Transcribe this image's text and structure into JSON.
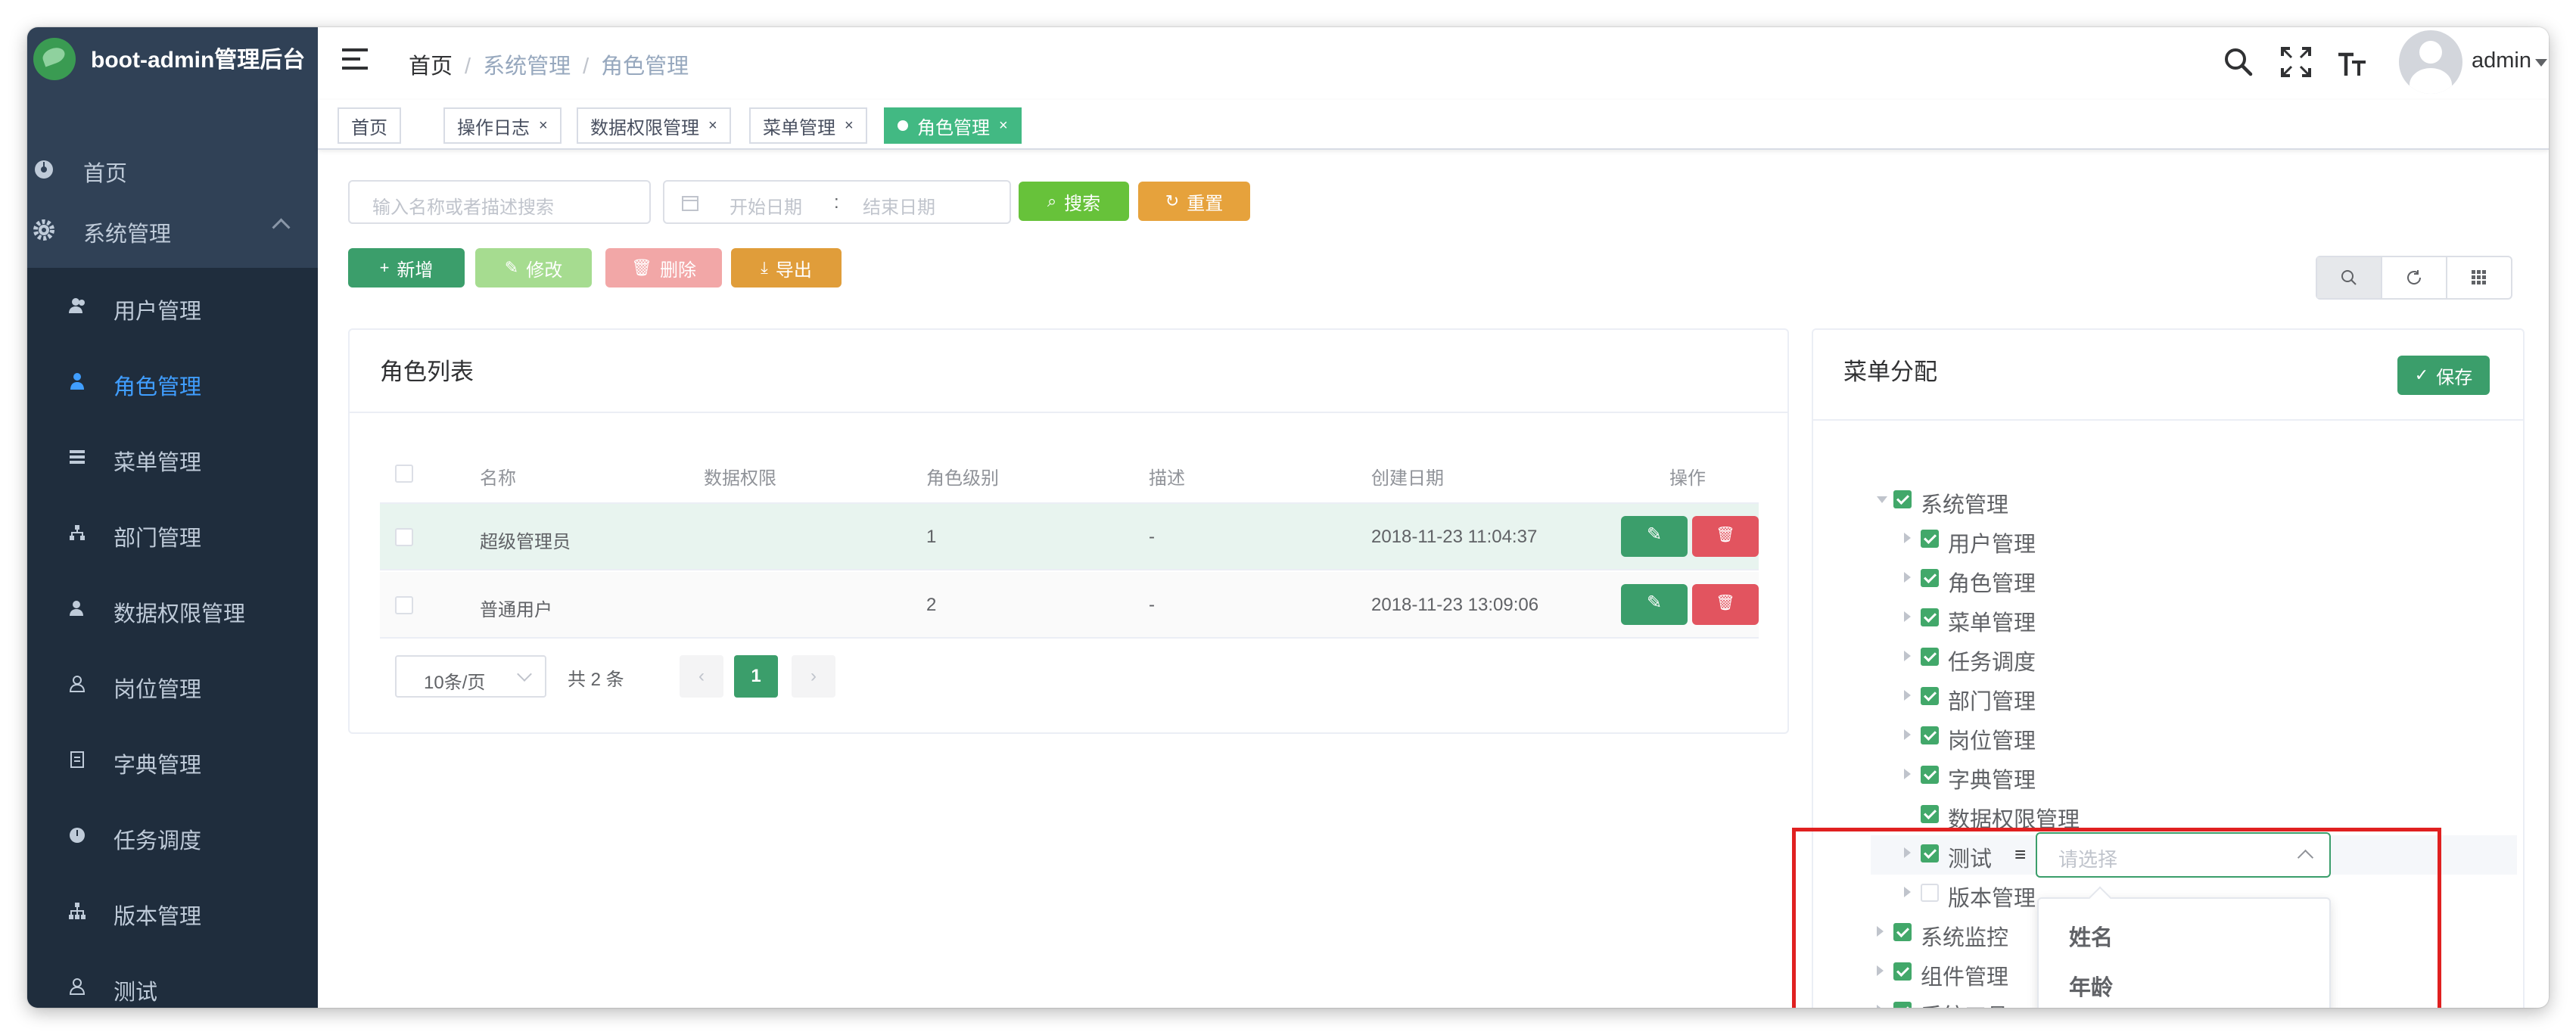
{
  "app": {
    "title": "boot-admin管理后台"
  },
  "sidebar": {
    "home": "首页",
    "group": "系统管理",
    "items": [
      {
        "label": "用户管理",
        "icon": "user-icon"
      },
      {
        "label": "角色管理",
        "icon": "role-icon",
        "active": true
      },
      {
        "label": "菜单管理",
        "icon": "menu-icon"
      },
      {
        "label": "部门管理",
        "icon": "dept-icon"
      },
      {
        "label": "数据权限管理",
        "icon": "data-perm-icon"
      },
      {
        "label": "岗位管理",
        "icon": "post-icon"
      },
      {
        "label": "字典管理",
        "icon": "dict-icon"
      },
      {
        "label": "任务调度",
        "icon": "task-icon"
      },
      {
        "label": "版本管理",
        "icon": "version-icon"
      },
      {
        "label": "测试",
        "icon": "test-icon"
      }
    ]
  },
  "header": {
    "breadcrumb": [
      "首页",
      "系统管理",
      "角色管理"
    ],
    "username": "admin"
  },
  "tags": [
    {
      "label": "首页",
      "closable": false
    },
    {
      "label": "操作日志",
      "closable": true
    },
    {
      "label": "数据权限管理",
      "closable": true
    },
    {
      "label": "菜单管理",
      "closable": true
    },
    {
      "label": "角色管理",
      "closable": true,
      "active": true
    }
  ],
  "toolbar": {
    "search_placeholder": "输入名称或者描述搜索",
    "start_date_placeholder": "开始日期",
    "date_sep": ":",
    "end_date_placeholder": "结束日期",
    "search_btn": "搜索",
    "reset_btn": "重置",
    "add_btn": "新增",
    "edit_btn": "修改",
    "delete_btn": "删除",
    "export_btn": "导出"
  },
  "role_list": {
    "title": "角色列表",
    "columns": [
      "名称",
      "数据权限",
      "角色级别",
      "描述",
      "创建日期",
      "操作"
    ],
    "rows": [
      {
        "name": "超级管理员",
        "data_scope": "",
        "level": "1",
        "desc": "-",
        "created": "2018-11-23 11:04:37"
      },
      {
        "name": "普通用户",
        "data_scope": "",
        "level": "2",
        "desc": "-",
        "created": "2018-11-23 13:09:06"
      }
    ],
    "pagination": {
      "page_size": "10条/页",
      "total": "共 2 条",
      "current": "1"
    }
  },
  "menu_assign": {
    "title": "菜单分配",
    "save_btn": "保存",
    "tree": [
      {
        "label": "系统管理",
        "level": 0,
        "checked": true,
        "expanded": true
      },
      {
        "label": "用户管理",
        "level": 1,
        "checked": true
      },
      {
        "label": "角色管理",
        "level": 1,
        "checked": true
      },
      {
        "label": "菜单管理",
        "level": 1,
        "checked": true
      },
      {
        "label": "任务调度",
        "level": 1,
        "checked": true
      },
      {
        "label": "部门管理",
        "level": 1,
        "checked": true
      },
      {
        "label": "岗位管理",
        "level": 1,
        "checked": true
      },
      {
        "label": "字典管理",
        "level": 1,
        "checked": true
      },
      {
        "label": "数据权限管理",
        "level": 1,
        "checked": true,
        "leaf": true
      },
      {
        "label": "测试",
        "level": 1,
        "checked": true,
        "has_select": true
      },
      {
        "label": "版本管理",
        "level": 1,
        "checked": false
      },
      {
        "label": "系统监控",
        "level": 0,
        "checked": true
      },
      {
        "label": "组件管理",
        "level": 0,
        "checked": true
      },
      {
        "label": "系统工具",
        "level": 0,
        "checked": true
      }
    ],
    "select_placeholder": "请选择",
    "options": [
      "姓名",
      "年龄"
    ]
  },
  "colors": {
    "sidebar_bg": "#304156",
    "submenu_bg": "#1f2d3d",
    "active_menu": "#409eff",
    "primary_green": "#3b9e6b",
    "tag_active": "#42b983",
    "danger": "#e2545f",
    "warning": "#e6a23c",
    "highlight_box": "#e02020"
  }
}
